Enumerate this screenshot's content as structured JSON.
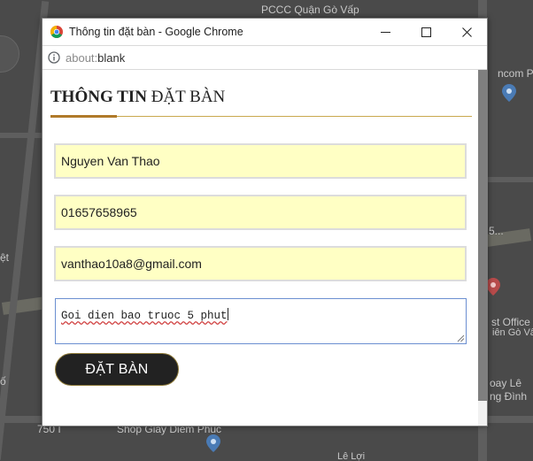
{
  "background_map": {
    "labels": [
      {
        "id": "pccc",
        "text": "PCCC Quận Gò Vấp"
      },
      {
        "id": "ncom",
        "text": "ncom P"
      },
      {
        "id": "et",
        "text": "ệt"
      },
      {
        "id": "st-office",
        "text": "st Office"
      },
      {
        "id": "ien-go-vap",
        "text": "iên Gò Vấp"
      },
      {
        "id": "oay-le",
        "text": "oay Lê"
      },
      {
        "id": "ng-dinh",
        "text": "ng Đình"
      },
      {
        "id": "o-left",
        "text": "ố"
      },
      {
        "id": "shop",
        "text": "Shop Giày Diễm Phúc"
      },
      {
        "id": "le-loi",
        "text": "Lê Lợi"
      },
      {
        "id": "num-750",
        "text": "750 I"
      },
      {
        "id": "dots",
        "text": "5..."
      }
    ]
  },
  "window": {
    "title": "Thông tin đặt bàn - Google Chrome",
    "controls": {
      "minimize": "minimize",
      "maximize": "maximize",
      "close": "close"
    }
  },
  "address_bar": {
    "scheme": "about:",
    "path": "blank"
  },
  "form": {
    "heading_bold": "THÔNG TIN",
    "heading_rest": " ĐẶT BÀN",
    "name_value": "Nguyen Van Thao",
    "phone_value": "01657658965",
    "email_value": "vanthao10a8@gmail.com",
    "note_value": "Goi dien bao truoc 5 phut",
    "submit_label": "ĐẶT BÀN"
  },
  "colors": {
    "input_background": "#ffffc4",
    "heading_accent": "#b07a2a",
    "button_background": "#222222",
    "focus_border": "#6b8fd1"
  }
}
